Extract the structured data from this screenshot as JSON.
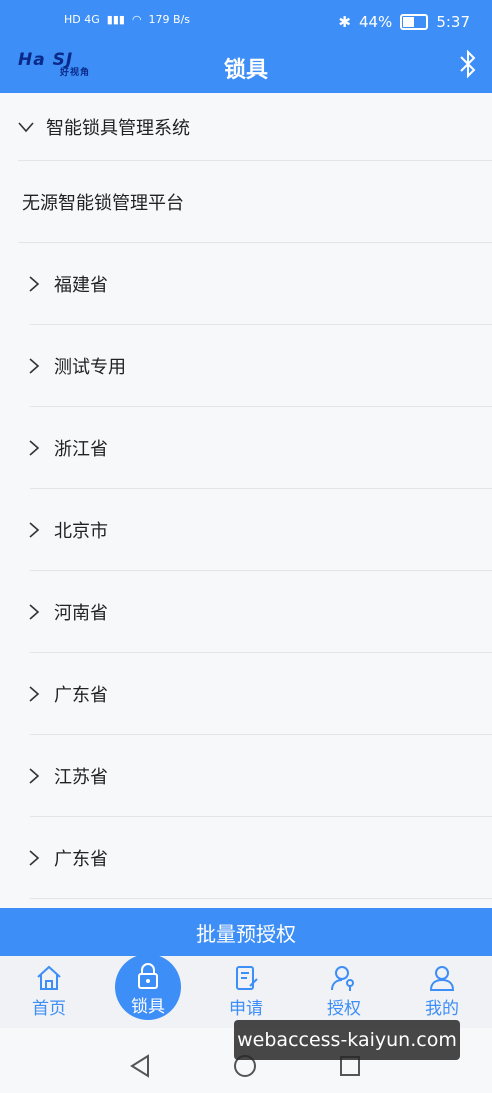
{
  "status": {
    "network_left": "HD 4G",
    "speed": "179 B/s",
    "battery": "44%",
    "time": "5:37"
  },
  "header": {
    "logo_main": "Ha SJ",
    "logo_sub": "好视角",
    "title": "锁具",
    "bluetooth_icon": "bluetooth-icon"
  },
  "tree": {
    "root": "智能锁具管理系统",
    "platform": "无源智能锁管理平台",
    "provinces": [
      "福建省",
      "测试专用",
      "浙江省",
      "北京市",
      "河南省",
      "广东省",
      "江苏省",
      "广东省"
    ]
  },
  "batch_button": "批量预授权",
  "tabs": {
    "home": "首页",
    "locks": "锁具",
    "apply": "申请",
    "authorize": "授权",
    "mine": "我的"
  },
  "watermark": "webaccess-kaiyun.com",
  "colors": {
    "primary": "#3d8ef6",
    "background": "#f7f8fa"
  }
}
